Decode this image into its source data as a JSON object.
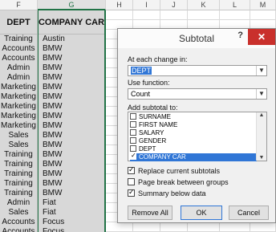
{
  "columns": [
    "F",
    "G",
    "H",
    "I",
    "J",
    "K",
    "L",
    "M"
  ],
  "header": {
    "dept": "DEPT",
    "car": "COMPANY CAR"
  },
  "rows": [
    [
      "Training",
      "Austin"
    ],
    [
      "Accounts",
      "BMW"
    ],
    [
      "Accounts",
      "BMW"
    ],
    [
      "Admin",
      "BMW"
    ],
    [
      "Admin",
      "BMW"
    ],
    [
      "Marketing",
      "BMW"
    ],
    [
      "Marketing",
      "BMW"
    ],
    [
      "Marketing",
      "BMW"
    ],
    [
      "Marketing",
      "BMW"
    ],
    [
      "Marketing",
      "BMW"
    ],
    [
      "Sales",
      "BMW"
    ],
    [
      "Sales",
      "BMW"
    ],
    [
      "Training",
      "BMW"
    ],
    [
      "Training",
      "BMW"
    ],
    [
      "Training",
      "BMW"
    ],
    [
      "Training",
      "BMW"
    ],
    [
      "Training",
      "BMW"
    ],
    [
      "Admin",
      "Fiat"
    ],
    [
      "Sales",
      "Fiat"
    ],
    [
      "Accounts",
      "Focus"
    ],
    [
      "Accounts",
      "Focus"
    ]
  ],
  "dialog": {
    "title": "Subtotal",
    "help": "?",
    "close": "✕",
    "at_each_change_label": "At each change in:",
    "at_each_change_value": "DEPT",
    "use_function_label": "Use function:",
    "use_function_value": "Count",
    "add_subtotal_label": "Add subtotal to:",
    "fields": [
      {
        "name": "SURNAME",
        "checked": false
      },
      {
        "name": "FIRST NAME",
        "checked": false
      },
      {
        "name": "SALARY",
        "checked": false
      },
      {
        "name": "GENDER",
        "checked": false
      },
      {
        "name": "DEPT",
        "checked": false
      },
      {
        "name": "COMPANY CAR",
        "checked": true
      }
    ],
    "replace_label": "Replace current subtotals",
    "replace_checked": true,
    "page_break_label": "Page break between groups",
    "page_break_checked": false,
    "summary_label": "Summary below data",
    "summary_checked": true,
    "remove_all": "Remove All",
    "ok": "OK",
    "cancel": "Cancel"
  }
}
